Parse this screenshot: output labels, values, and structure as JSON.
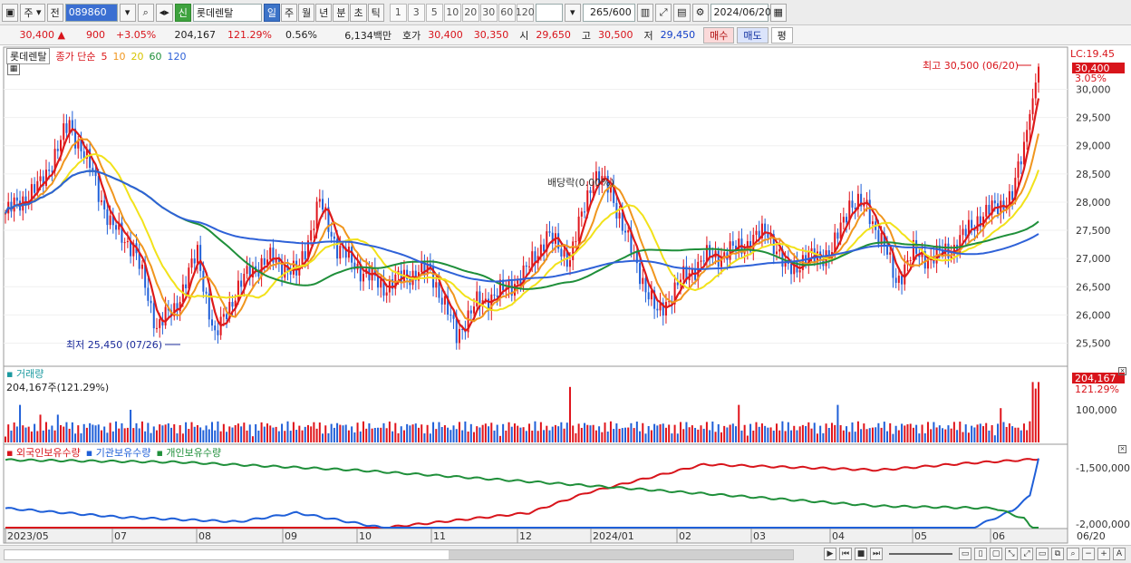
{
  "toolbar": {
    "type_select": "주",
    "prev_label": "전",
    "stock_code": "089860",
    "badge": "신",
    "stock_name": "롯데렌탈",
    "period_tabs": [
      "일",
      "주",
      "월",
      "년",
      "분",
      "초",
      "틱"
    ],
    "active_period": "일",
    "intervals": [
      "1",
      "3",
      "5",
      "10",
      "20",
      "30",
      "60",
      "120"
    ],
    "count_value": "265",
    "count_total": "/600",
    "date": "2024/06/20"
  },
  "quote": {
    "price": "30,400",
    "change": "900",
    "change_pct": "+3.05%",
    "volume": "204,167",
    "volume_ratio": "121.29%",
    "turnover": "0.56%",
    "amount": "6,134백만",
    "bid_label": "호가",
    "ask": "30,400",
    "bid": "30,350",
    "open_label": "시",
    "open": "29,650",
    "high_label": "고",
    "high": "30,500",
    "low_label": "저",
    "low": "29,450",
    "buy_label": "매수",
    "sell_label": "매도",
    "eval_label": "평"
  },
  "price_pane": {
    "stock_tag": "롯데렌탈",
    "ma_title": "종가 단순",
    "ma_periods": [
      "5",
      "10",
      "20",
      "60",
      "120"
    ],
    "lc_label": "LC:19.45",
    "current_price_tag": "30,400",
    "current_pct_tag": "3.05%",
    "high_annotation": "최고 30,500 (06/20)",
    "low_annotation": "최저 25,450 (07/26)",
    "dividend_annotation": "배당락(0.00%)",
    "y_ticks": [
      "30,000",
      "29,500",
      "29,000",
      "28,500",
      "28,000",
      "27,500",
      "27,000",
      "26,500",
      "26,000",
      "25,500"
    ]
  },
  "volume_pane": {
    "title": "거래량",
    "summary": "204,167주(121.29%)",
    "current_tag": "204,167",
    "current_pct": "121.29%",
    "y_tick": "100,000"
  },
  "holdings_pane": {
    "legend": [
      "외국인보유수량",
      "기관보유수량",
      "개인보유수량"
    ],
    "y_ticks": [
      "-1,500,000",
      "-2,000,000"
    ]
  },
  "x_axis": {
    "labels": [
      "2023/05",
      "07",
      "08",
      "09",
      "10",
      "11",
      "12",
      "2024/01",
      "02",
      "03",
      "04",
      "05",
      "06"
    ],
    "last_label": "06/20"
  },
  "colors": {
    "up": "#e0141b",
    "down": "#1f5fd8",
    "ma5": "#dd1a1a",
    "ma10": "#f0961e",
    "ma20": "#f2e21a",
    "ma60": "#1f8f3a",
    "ma120": "#2f62d8"
  }
}
